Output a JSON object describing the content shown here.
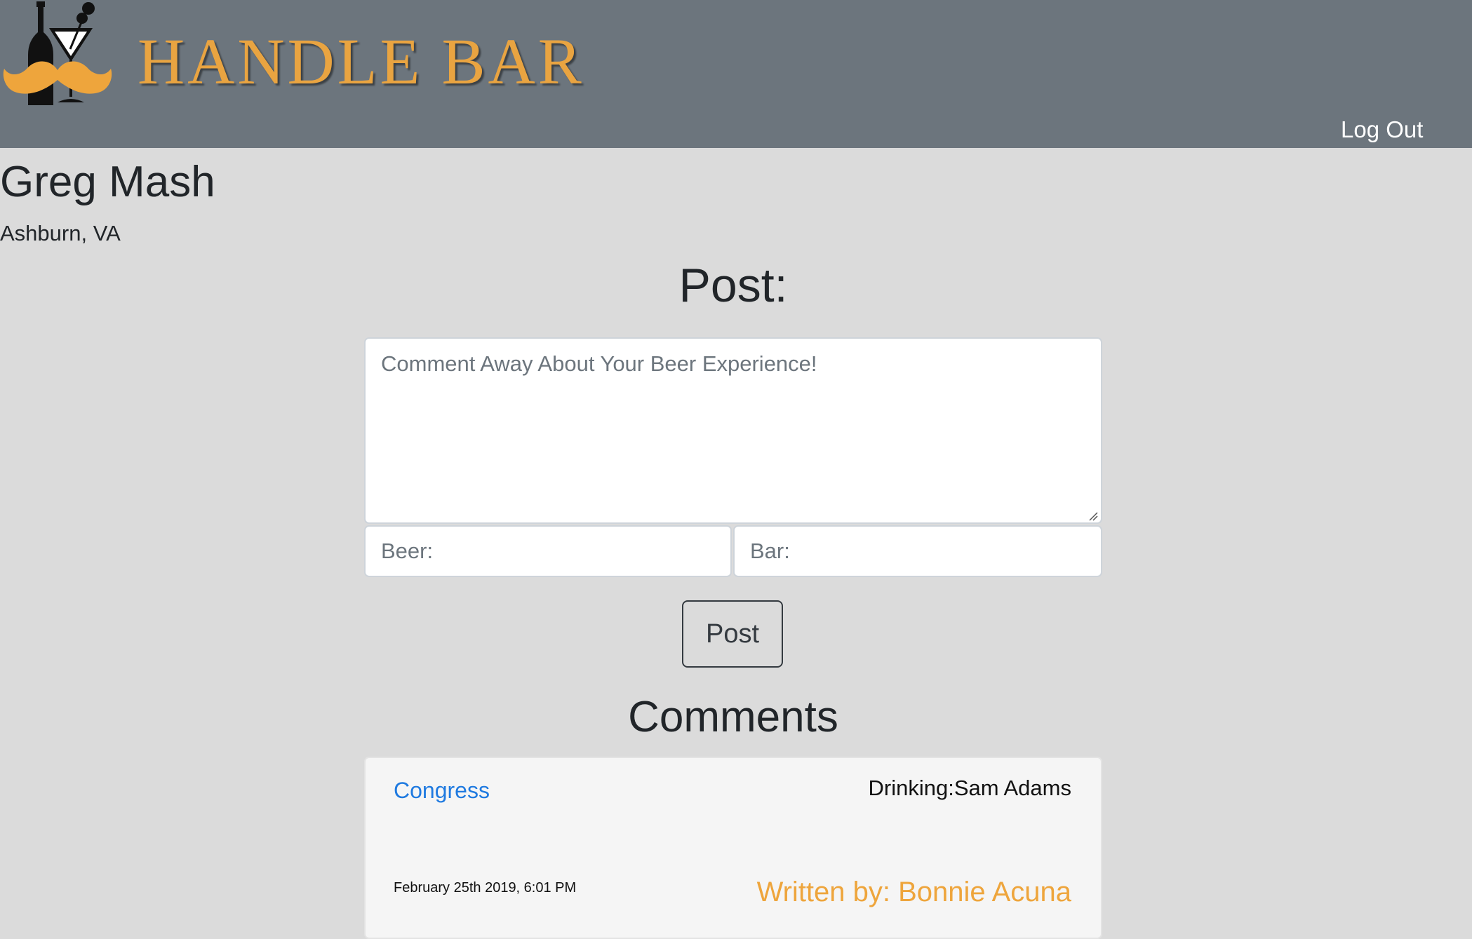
{
  "header": {
    "brand_name": "HANDLE BAR",
    "logout_label": "Log Out",
    "brand_color": "#e9a441",
    "header_bg": "#6c757d",
    "logo_icons": [
      "bottle-icon",
      "martini-glass-icon",
      "mustache-icon"
    ]
  },
  "profile": {
    "name": "Greg Mash",
    "location": "Ashburn, VA"
  },
  "post_form": {
    "heading": "Post:",
    "comment_placeholder": "Comment Away About Your Beer Experience!",
    "comment_value": "",
    "beer_placeholder": "Beer:",
    "beer_value": "",
    "bar_placeholder": "Bar:",
    "bar_value": "",
    "submit_label": "Post"
  },
  "comments": {
    "heading": "Comments",
    "items": [
      {
        "bar": "Congress",
        "drinking": "Drinking:Sam Adams",
        "date": "February 25th 2019, 6:01 PM",
        "author": "Written by: Bonnie Acuna"
      }
    ]
  }
}
